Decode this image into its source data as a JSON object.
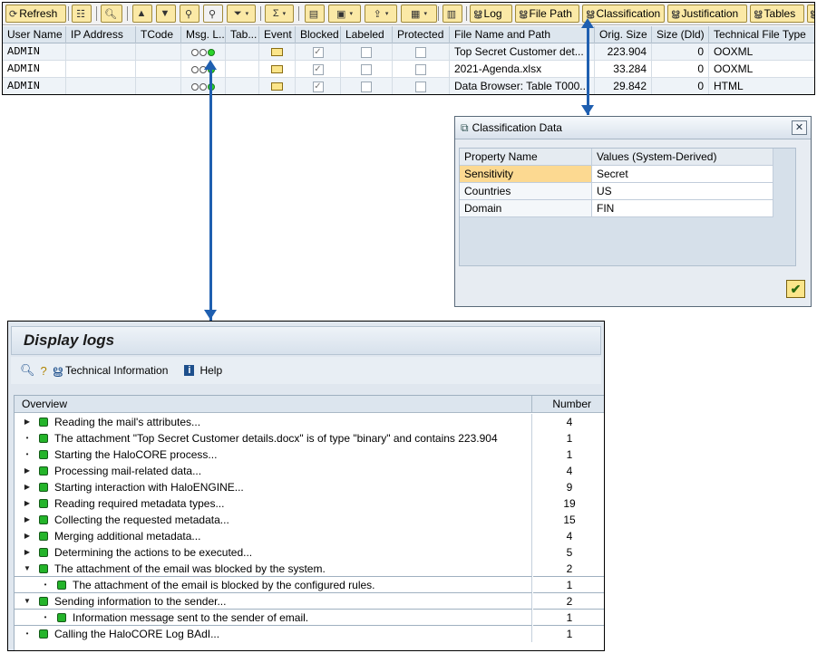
{
  "toolbar": {
    "refresh_label": "Refresh",
    "log_label": "Log",
    "file_path_label": "File Path",
    "classification_label": "Classification",
    "justification_label": "Justification",
    "tables_label": "Tables"
  },
  "grid": {
    "columns": [
      "User Name",
      "IP Address",
      "TCode",
      "Msg. L...",
      "Tab...",
      "Event",
      "Blocked",
      "Labeled",
      "Protected",
      "File Name and Path",
      "Orig. Size",
      "Size (Dld)",
      "Technical File Type"
    ],
    "rows": [
      {
        "user": "ADMIN",
        "ip": "",
        "tcode": "",
        "blocked": true,
        "labeled": false,
        "protected": false,
        "file": "Top Secret Customer det...",
        "orig_size": "223.904",
        "size_dld": "0",
        "type": "OOXML"
      },
      {
        "user": "ADMIN",
        "ip": "",
        "tcode": "",
        "blocked": true,
        "labeled": false,
        "protected": false,
        "file": "2021-Agenda.xlsx",
        "orig_size": "33.284",
        "size_dld": "0",
        "type": "OOXML"
      },
      {
        "user": "ADMIN",
        "ip": "",
        "tcode": "",
        "blocked": true,
        "labeled": false,
        "protected": false,
        "file": "Data Browser: Table T000...",
        "orig_size": "29.842",
        "size_dld": "0",
        "type": "HTML"
      }
    ]
  },
  "dialog": {
    "title": "Classification Data",
    "col_property": "Property Name",
    "col_values": "Values (System-Derived)",
    "rows": [
      {
        "name": "Sensitivity",
        "value": "Secret"
      },
      {
        "name": "Countries",
        "value": "US"
      },
      {
        "name": "Domain",
        "value": "FIN"
      }
    ]
  },
  "logs": {
    "title": "Display logs",
    "tech_info_label": "Technical Information",
    "help_label": "Help",
    "col_overview": "Overview",
    "col_number": "Number",
    "items": [
      {
        "text": "Reading the mail's attributes...",
        "count": "4"
      },
      {
        "text": "The attachment \"Top Secret Customer details.docx\" is of type \"binary\" and contains 223.904",
        "count": "1"
      },
      {
        "text": "Starting the HaloCORE process...",
        "count": "1"
      },
      {
        "text": "Processing mail-related data...",
        "count": "4"
      },
      {
        "text": "Starting interaction with HaloENGINE...",
        "count": "9"
      },
      {
        "text": "Reading required metadata types...",
        "count": "19"
      },
      {
        "text": "Collecting the requested metadata...",
        "count": "15"
      },
      {
        "text": "Merging additional metadata...",
        "count": "4"
      },
      {
        "text": "Determining the actions to be executed...",
        "count": "5"
      },
      {
        "text": "The attachment of the email was blocked by the system.",
        "count": "2"
      },
      {
        "text": "The attachment of the email is blocked by the configured rules.",
        "count": "1"
      },
      {
        "text": "Sending information to the sender...",
        "count": "2"
      },
      {
        "text": "Information message sent to the sender of email.",
        "count": "1"
      },
      {
        "text": "Calling the HaloCORE Log BAdI...",
        "count": "1"
      }
    ]
  }
}
